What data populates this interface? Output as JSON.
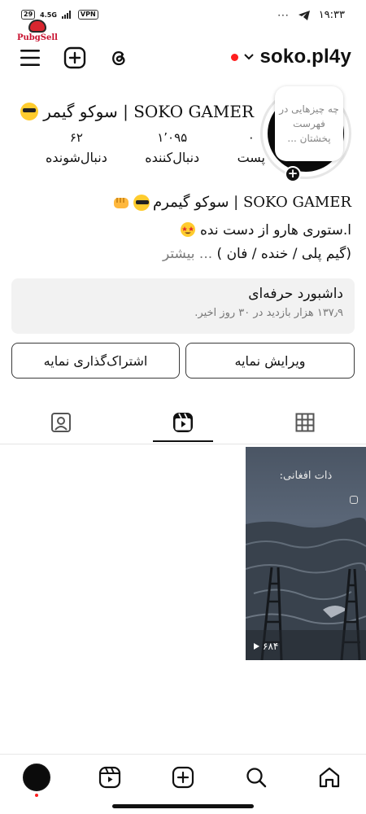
{
  "status_bar": {
    "battery": "29",
    "network": "4.5G",
    "vpn": "VPN",
    "time": "۱۹:۳۳",
    "more": "···"
  },
  "watermark": {
    "text": "PubgSell"
  },
  "header": {
    "username": "soko.pl4y",
    "icons": [
      "menu-icon",
      "add-icon",
      "threads-icon",
      "chevron-down-icon"
    ]
  },
  "profile": {
    "display_name": "SOKO GAMER | سوکو گیمر",
    "note": "چه چیزهایی در فهرست پخشتان ...",
    "stats": [
      {
        "value": "۰",
        "label": "پست"
      },
      {
        "value": "۱٬۰۹۵",
        "label": "دنبال‌کننده"
      },
      {
        "value": "۶۲",
        "label": "دنبال‌شونده"
      }
    ]
  },
  "bio": {
    "title": "SOKO GAMER | سوکو گیمرم",
    "line1": "ا.ستوری هارو از دست نده",
    "line2": "(گیم پلی / خنده / فان )",
    "more": "... بیشتر"
  },
  "dashboard": {
    "title": "داشبورد حرفه‌ای",
    "subtitle": "۱۳۷٫۹ هزار بازدید در ۳۰ روز اخیر."
  },
  "buttons": {
    "edit": "ویرایش نمایه",
    "share": "اشتراک‌گذاری نمایه"
  },
  "reel": {
    "caption": "ذات افغانی:",
    "views": "۶۸۴"
  },
  "colors": {
    "accent": "#ff1e1e",
    "text": "#111111",
    "muted": "#777777",
    "card": "#f2f2f2"
  }
}
